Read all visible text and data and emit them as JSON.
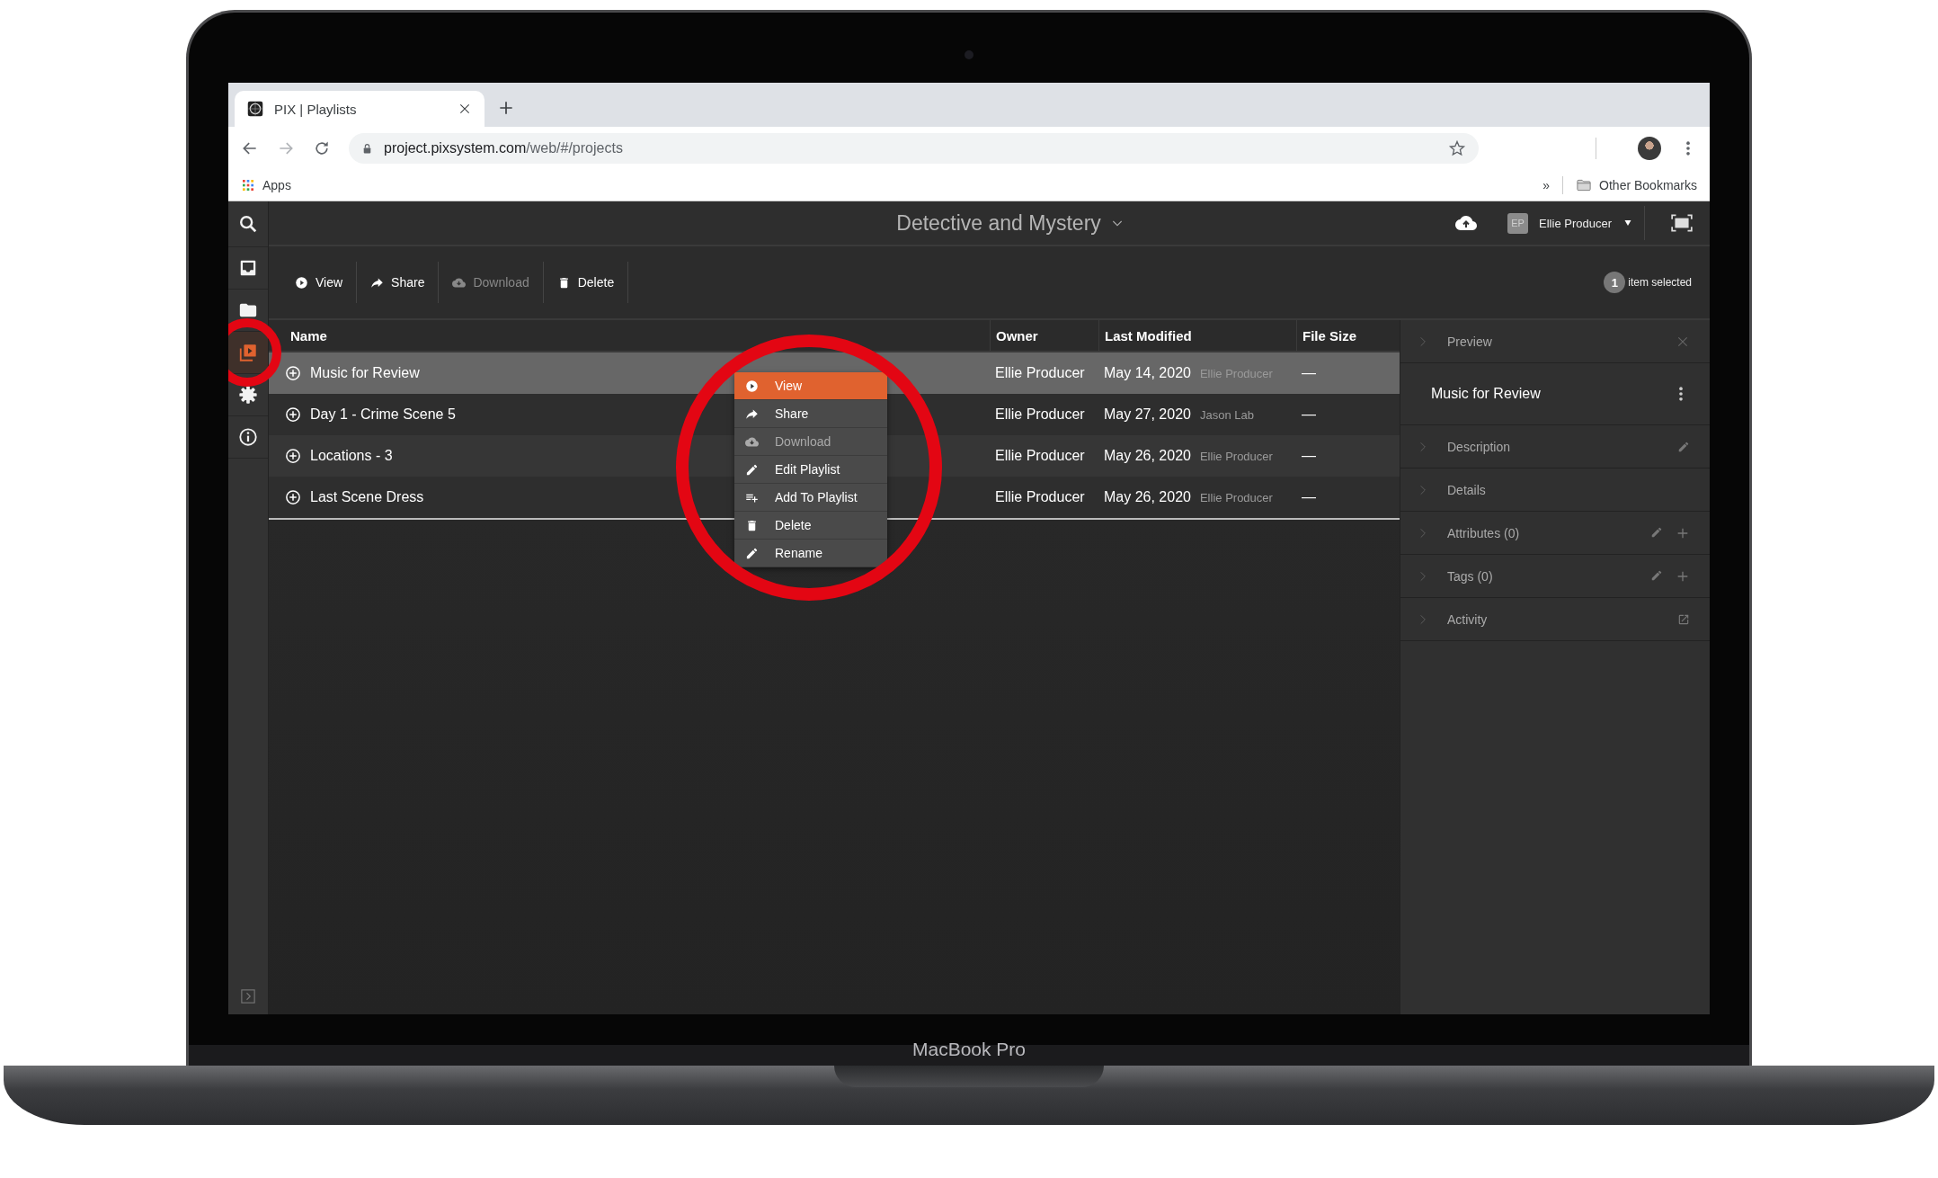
{
  "browser": {
    "tab_title": "PIX | Playlists",
    "url_host": "project.pixsystem.com",
    "url_path": "/web/#/projects",
    "bookmarks": [
      {
        "label": "Apps"
      }
    ],
    "overflow": "»",
    "other_bookmarks": "Other Bookmarks"
  },
  "sidebar": {
    "items": [
      {
        "kind": "search",
        "selected": false
      },
      {
        "kind": "inbox",
        "selected": false
      },
      {
        "kind": "folder",
        "selected": false
      },
      {
        "kind": "playlists",
        "selected": true
      },
      {
        "kind": "settings",
        "selected": false
      },
      {
        "kind": "info",
        "selected": false
      }
    ]
  },
  "header": {
    "title": "Detective and Mystery",
    "user_initials": "EP",
    "user_name": "Ellie Producer"
  },
  "toolbar": {
    "actions": [
      {
        "kind": "view",
        "label": "View",
        "disabled": false
      },
      {
        "kind": "share",
        "label": "Share",
        "disabled": false
      },
      {
        "kind": "download",
        "label": "Download",
        "disabled": true
      },
      {
        "kind": "delete",
        "label": "Delete",
        "disabled": false
      }
    ],
    "selection_count": "1",
    "selection_label": "item selected"
  },
  "table": {
    "columns": [
      "Name",
      "Owner",
      "Last Modified",
      "File Size"
    ],
    "rows": [
      {
        "name": "Music for Review",
        "owner": "Ellie Producer",
        "last_modified": "May 14, 2020",
        "modified_by": "Ellie Producer",
        "file_size": "—",
        "selected": true
      },
      {
        "name": "Day 1 - Crime Scene 5",
        "owner": "Ellie Producer",
        "last_modified": "May 27, 2020",
        "modified_by": "Jason Lab",
        "file_size": "—",
        "selected": false
      },
      {
        "name": "Locations - 3",
        "owner": "Ellie Producer",
        "last_modified": "May 26, 2020",
        "modified_by": "Ellie Producer",
        "file_size": "—",
        "selected": false
      },
      {
        "name": "Last Scene Dress",
        "owner": "Ellie Producer",
        "last_modified": "May 26, 2020",
        "modified_by": "Ellie Producer",
        "file_size": "—",
        "selected": false
      }
    ]
  },
  "context_menu": {
    "items": [
      {
        "kind": "view",
        "label": "View",
        "selected": true,
        "disabled": false
      },
      {
        "kind": "share",
        "label": "Share",
        "selected": false,
        "disabled": false
      },
      {
        "kind": "download",
        "label": "Download",
        "selected": false,
        "disabled": true
      },
      {
        "kind": "edit",
        "label": "Edit Playlist",
        "selected": false,
        "disabled": false
      },
      {
        "kind": "add",
        "label": "Add To Playlist",
        "selected": false,
        "disabled": false
      },
      {
        "kind": "delete",
        "label": "Delete",
        "selected": false,
        "disabled": false
      },
      {
        "kind": "rename",
        "label": "Rename",
        "selected": false,
        "disabled": false
      }
    ]
  },
  "details_panel": {
    "header": "Preview",
    "title": "Music for Review",
    "sections": [
      {
        "label": "Description",
        "kind": "editable"
      },
      {
        "label": "Details",
        "kind": "plain"
      },
      {
        "label": "Attributes (0)",
        "kind": "list"
      },
      {
        "label": "Tags (0)",
        "kind": "list"
      },
      {
        "label": "Activity",
        "kind": "link"
      }
    ]
  },
  "highlights": [
    {
      "kind": "ring"
    },
    {
      "kind": "ring"
    }
  ],
  "device": {
    "label": "MacBook Pro"
  }
}
